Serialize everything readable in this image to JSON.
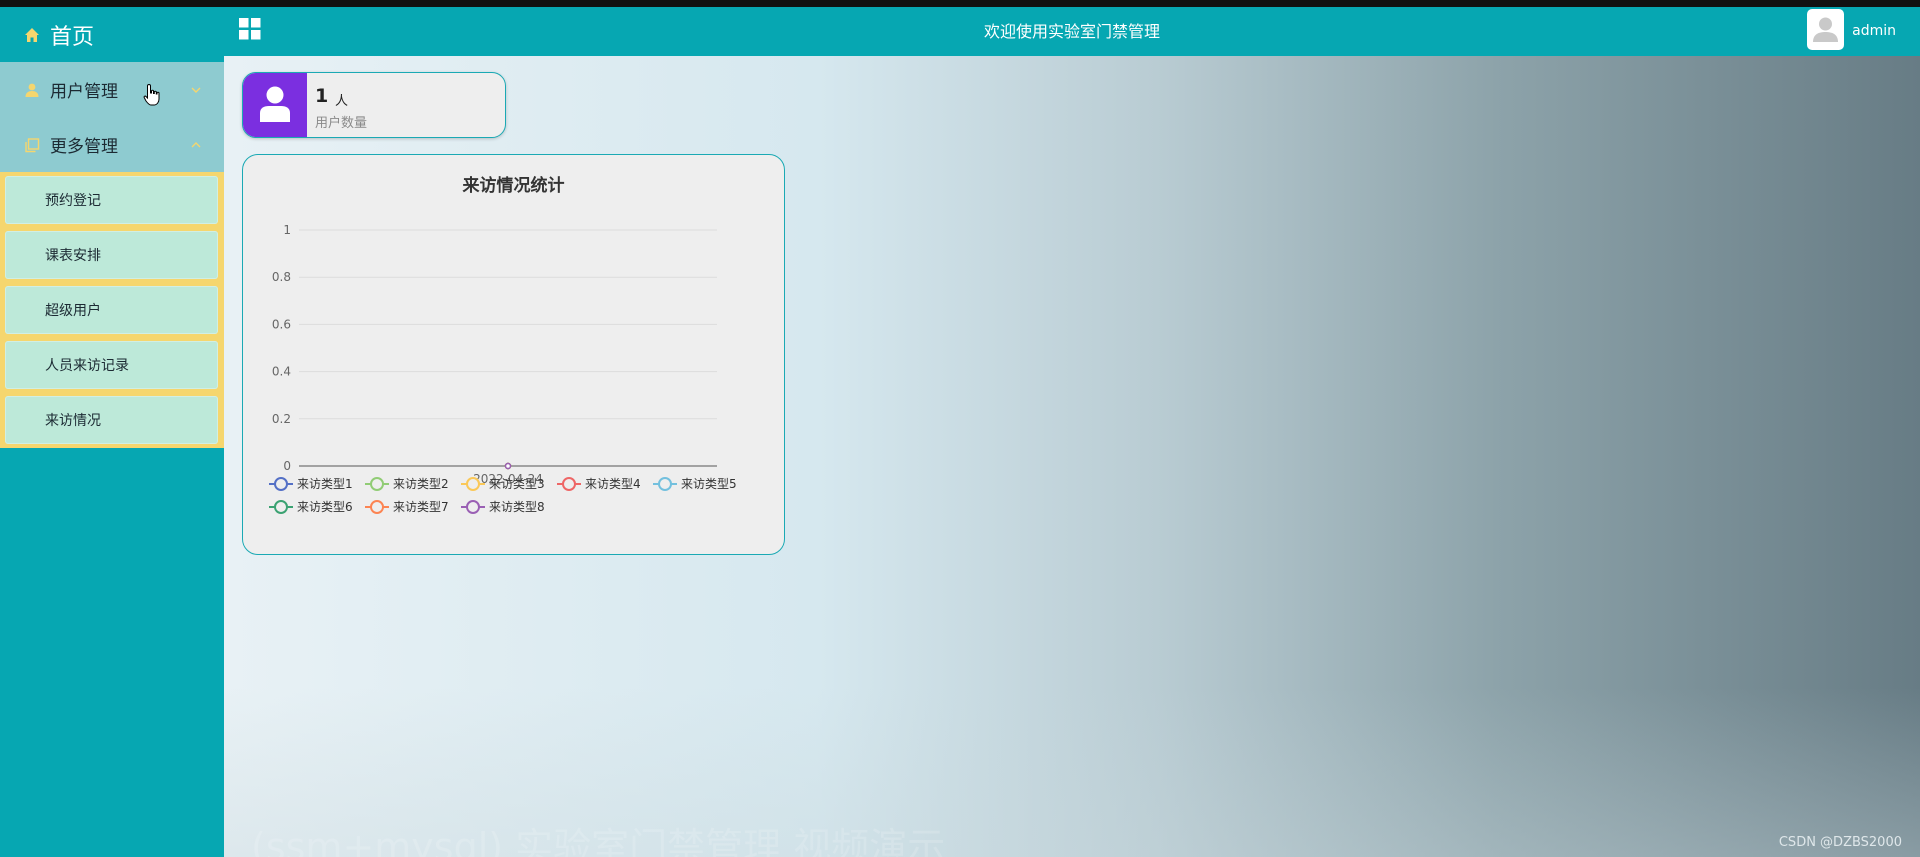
{
  "sidebar": {
    "home_label": "首页",
    "groups": [
      {
        "label": "用户管理",
        "expanded": false
      },
      {
        "label": "更多管理",
        "expanded": true
      }
    ],
    "items": [
      {
        "label": "预约登记"
      },
      {
        "label": "课表安排"
      },
      {
        "label": "超级用户"
      },
      {
        "label": "人员来访记录"
      },
      {
        "label": "来访情况"
      }
    ]
  },
  "header": {
    "welcome": "欢迎使用实验室门禁管理",
    "username": "admin"
  },
  "stat_card": {
    "value": "1",
    "unit": "人",
    "label": "用户数量",
    "icon": "user-icon",
    "icon_bg": "#7b2fe0"
  },
  "chart_data": {
    "type": "line",
    "title": "来访情况统计",
    "categories": [
      "2022-04-24"
    ],
    "ylim": [
      0,
      1
    ],
    "yticks": [
      "0",
      "0.2",
      "0.4",
      "0.6",
      "0.8",
      "1"
    ],
    "grid": true,
    "legend_position": "bottom",
    "series": [
      {
        "name": "来访类型1",
        "values": [
          0
        ],
        "color": "#5470c6"
      },
      {
        "name": "来访类型2",
        "values": [
          0
        ],
        "color": "#91cc75"
      },
      {
        "name": "来访类型3",
        "values": [
          0
        ],
        "color": "#fac858"
      },
      {
        "name": "来访类型4",
        "values": [
          0
        ],
        "color": "#ee6666"
      },
      {
        "name": "来访类型5",
        "values": [
          0
        ],
        "color": "#73c0de"
      },
      {
        "name": "来访类型6",
        "values": [
          0
        ],
        "color": "#3ba272"
      },
      {
        "name": "来访类型7",
        "values": [
          0
        ],
        "color": "#fc8452"
      },
      {
        "name": "来访类型8",
        "values": [
          0
        ],
        "color": "#9a60b4"
      }
    ]
  },
  "watermark": "(ssm+mysql) 实验室门禁管理 视频演示",
  "credit": "CSDN @DZBS2000",
  "colors": {
    "sidebar": "#06a7b2",
    "header": "#06a7b2",
    "submenu_bg": "#f5d66e",
    "submenu_item": "#bde9d9",
    "card_border": "#1aa9b4"
  }
}
